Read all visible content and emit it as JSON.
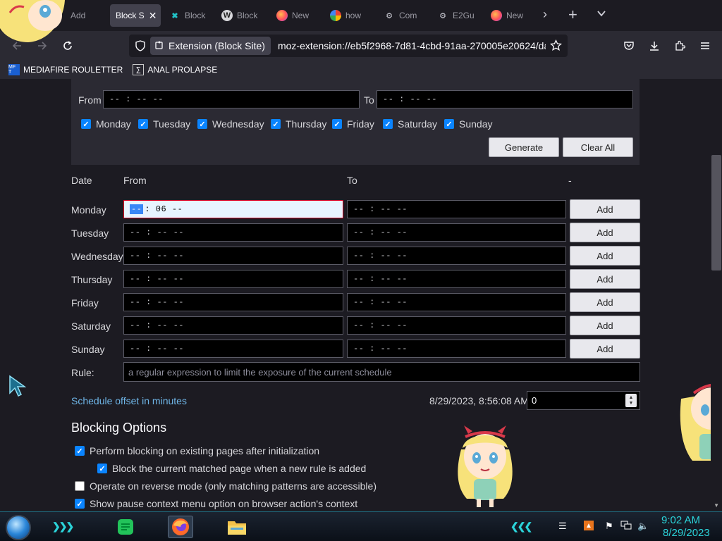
{
  "browser": {
    "tabs": [
      {
        "label": "Add"
      },
      {
        "label": "Block S",
        "active": true
      },
      {
        "label": "Block"
      },
      {
        "label": "Block"
      },
      {
        "label": "New"
      },
      {
        "label": "how"
      },
      {
        "label": "Com"
      },
      {
        "label": "E2Gu"
      },
      {
        "label": "New"
      }
    ],
    "new_tab_icon": "+",
    "tab_list_icon": "chevron-down",
    "extension_chip": "Extension (Block Site)",
    "url": "moz-extension://eb5f2968-7d81-4cbd-91aa-270005e20624/da",
    "bookmarks": [
      {
        "label": "MEDIAFIRE ROULETTER",
        "icon": "MF T"
      },
      {
        "label": "ANAL PROLAPSE",
        "icon": "∑"
      }
    ]
  },
  "page": {
    "generator": {
      "from_label": "From",
      "to_label": "To",
      "from_value": "-- : --  --",
      "to_value": "-- : --  --",
      "days": [
        "Monday",
        "Tuesday",
        "Wednesday",
        "Thursday",
        "Friday",
        "Saturday",
        "Sunday"
      ],
      "generate_label": "Generate",
      "clear_label": "Clear All"
    },
    "table": {
      "headers": {
        "date": "Date",
        "from": "From",
        "to": "To",
        "extra": "-"
      },
      "rows": [
        {
          "day": "Monday",
          "from_sel": "--",
          "from_rest": ": 06  --",
          "to": "-- : --  --",
          "add": "Add"
        },
        {
          "day": "Tuesday",
          "from": "-- : --  --",
          "to": "-- : --  --",
          "add": "Add"
        },
        {
          "day": "Wednesday",
          "from": "-- : --  --",
          "to": "-- : --  --",
          "add": "Add"
        },
        {
          "day": "Thursday",
          "from": "-- : --  --",
          "to": "-- : --  --",
          "add": "Add"
        },
        {
          "day": "Friday",
          "from": "-- : --  --",
          "to": "-- : --  --",
          "add": "Add"
        },
        {
          "day": "Saturday",
          "from": "-- : --  --",
          "to": "-- : --  --",
          "add": "Add"
        },
        {
          "day": "Sunday",
          "from": "-- : --  --",
          "to": "-- : --  --",
          "add": "Add"
        }
      ],
      "rule_label": "Rule:",
      "rule_placeholder": "a regular expression to limit the exposure of the current schedule"
    },
    "offset": {
      "link": "Schedule offset in minutes",
      "datetime": "8/29/2023, 8:56:08 AM",
      "value": "0"
    },
    "blocking": {
      "title": "Blocking Options",
      "options": [
        {
          "label": "Perform blocking on existing pages after initialization",
          "checked": true
        },
        {
          "label": "Block the current matched page when a new rule is added",
          "checked": true
        },
        {
          "label": "Operate on reverse mode (only matching patterns are accessible)",
          "checked": false
        },
        {
          "label": "Show pause context menu option on browser action's context",
          "checked": true
        }
      ]
    }
  },
  "taskbar": {
    "time": "9:02 AM",
    "date": "8/29/2023",
    "accent": "#2bd3d9"
  }
}
